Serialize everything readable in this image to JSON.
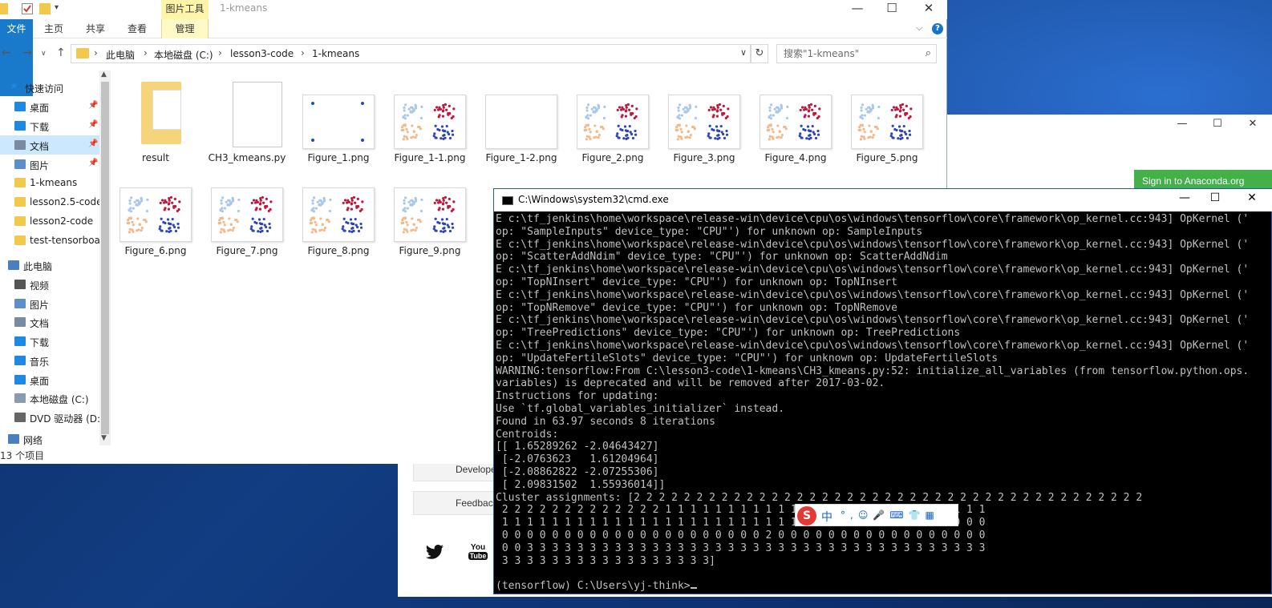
{
  "explorer": {
    "title": "1-kmeans",
    "context_tab": "图片工具",
    "ribbon_tabs": [
      "文件",
      "主页",
      "共享",
      "查看",
      "管理"
    ],
    "breadcrumbs": [
      "此电脑",
      "本地磁盘 (C:)",
      "lesson3-code",
      "1-kmeans"
    ],
    "search_placeholder": "搜索\"1-kmeans\"",
    "status": "13 个项目",
    "nav": [
      {
        "label": "快速访问",
        "icon": "star-icon"
      },
      {
        "label": "桌面",
        "icon": "desktop-icon",
        "pinned": true
      },
      {
        "label": "下载",
        "icon": "download-icon",
        "pinned": true
      },
      {
        "label": "文档",
        "icon": "documents-icon",
        "pinned": true,
        "selected": true
      },
      {
        "label": "图片",
        "icon": "pictures-icon",
        "pinned": true
      },
      {
        "label": "1-kmeans",
        "icon": "folder-icon"
      },
      {
        "label": "lesson2.5-code",
        "icon": "folder-icon"
      },
      {
        "label": "lesson2-code",
        "icon": "folder-icon"
      },
      {
        "label": "test-tensorboa",
        "icon": "folder-icon"
      },
      {
        "label": "此电脑",
        "icon": "computer-icon"
      },
      {
        "label": "视频",
        "icon": "videos-icon"
      },
      {
        "label": "图片",
        "icon": "pictures-icon"
      },
      {
        "label": "文档",
        "icon": "documents-icon"
      },
      {
        "label": "下载",
        "icon": "download-icon"
      },
      {
        "label": "音乐",
        "icon": "music-icon"
      },
      {
        "label": "桌面",
        "icon": "desktop-icon"
      },
      {
        "label": "本地磁盘 (C:)",
        "icon": "drive-icon"
      },
      {
        "label": "DVD 驱动器 (D:",
        "icon": "dvd-icon"
      },
      {
        "label": "网络",
        "icon": "network-icon"
      }
    ],
    "files": [
      {
        "name": "result",
        "kind": "folder"
      },
      {
        "name": "CH3_kmeans.py",
        "kind": "py"
      },
      {
        "name": "Figure_1.png",
        "kind": "blank-points"
      },
      {
        "name": "Figure_1-1.png",
        "kind": "scatter"
      },
      {
        "name": "Figure_1-2.png",
        "kind": "blank"
      },
      {
        "name": "Figure_2.png",
        "kind": "scatter"
      },
      {
        "name": "Figure_3.png",
        "kind": "scatter"
      },
      {
        "name": "Figure_4.png",
        "kind": "scatter"
      },
      {
        "name": "Figure_5.png",
        "kind": "scatter"
      },
      {
        "name": "Figure_6.png",
        "kind": "scatter"
      },
      {
        "name": "Figure_7.png",
        "kind": "scatter"
      },
      {
        "name": "Figure_8.png",
        "kind": "scatter"
      },
      {
        "name": "Figure_9.png",
        "kind": "scatter"
      }
    ]
  },
  "anaconda": {
    "signin": "Sign in to Anaconda.org",
    "developer_label": "Developer B",
    "feedback_label": "Feedback",
    "social": [
      "twitter-icon",
      "youtube-icon"
    ],
    "accent": "#43b049"
  },
  "cmd": {
    "title": "C:\\Windows\\system32\\cmd.exe",
    "lines": [
      "E c:\\tf_jenkins\\home\\workspace\\release-win\\device\\cpu\\os\\windows\\tensorflow\\core\\framework\\op_kernel.cc:943] OpKernel ('",
      "op: \"SampleInputs\" device_type: \"CPU\"') for unknown op: SampleInputs",
      "E c:\\tf_jenkins\\home\\workspace\\release-win\\device\\cpu\\os\\windows\\tensorflow\\core\\framework\\op_kernel.cc:943] OpKernel ('",
      "op: \"ScatterAddNdim\" device_type: \"CPU\"') for unknown op: ScatterAddNdim",
      "E c:\\tf_jenkins\\home\\workspace\\release-win\\device\\cpu\\os\\windows\\tensorflow\\core\\framework\\op_kernel.cc:943] OpKernel ('",
      "op: \"TopNInsert\" device_type: \"CPU\"') for unknown op: TopNInsert",
      "E c:\\tf_jenkins\\home\\workspace\\release-win\\device\\cpu\\os\\windows\\tensorflow\\core\\framework\\op_kernel.cc:943] OpKernel ('",
      "op: \"TopNRemove\" device_type: \"CPU\"') for unknown op: TopNRemove",
      "E c:\\tf_jenkins\\home\\workspace\\release-win\\device\\cpu\\os\\windows\\tensorflow\\core\\framework\\op_kernel.cc:943] OpKernel ('",
      "op: \"TreePredictions\" device_type: \"CPU\"') for unknown op: TreePredictions",
      "E c:\\tf_jenkins\\home\\workspace\\release-win\\device\\cpu\\os\\windows\\tensorflow\\core\\framework\\op_kernel.cc:943] OpKernel ('",
      "op: \"UpdateFertileSlots\" device_type: \"CPU\"') for unknown op: UpdateFertileSlots",
      "WARNING:tensorflow:From C:\\lesson3-code\\1-kmeans\\CH3_kmeans.py:52: initialize_all_variables (from tensorflow.python.ops.",
      "variables) is deprecated and will be removed after 2017-03-02.",
      "Instructions for updating:",
      "Use `tf.global_variables_initializer` instead.",
      "Found in 63.97 seconds 8 iterations",
      "Centroids:",
      "[[ 1.65289262 -2.04643427]",
      " [-2.0763623   1.61204964]",
      " [-2.08862822 -2.07255306]",
      " [ 2.09831502  1.55936014]]",
      "Cluster assignments: [2 2 2 2 2 2 2 2 2 2 2 2 2 2 2 2 2 2 2 2 2 2 2 2 2 2 2 2 2 2 2 2 2 2 2 2 2 2 2 2 2",
      " 2 2 2 2 2 2 2 2 2 2 2 2 2 1 1 1 1 1 1 1 1 1 1 1 1 1 1 1 1 1 1 1 1 1 1 1 1 1 1",
      " 1 1 1 1 1 1 1 1 1 1 1 1 1 1 1 1 1 1 1 1 1 1 1 1 1 1 1 1 0 0 0 0 0 0 0 0 0 0 0",
      " 0 0 0 0 0 0 0 0 0 0 0 0 0 0 0 0 0 0 0 0 0 2 0 0 0 0 0 0 0 0 0 0 0 0 0 0 0 0 0",
      " 0 0 3 3 3 3 3 3 3 3 3 3 3 3 3 3 3 3 3 3 3 3 3 3 3 3 3 3 3 3 3 3 3 3 3 3 3 3 3",
      " 3 3 3 3 3 3 3 3 3 3 3 3 3 3 3 3 3]",
      "",
      "(tensorflow) C:\\Users\\yj-think>"
    ]
  },
  "ime": {
    "logo": "S",
    "mode": "中",
    "extra": "°,☺🎤⌨👕▦"
  }
}
